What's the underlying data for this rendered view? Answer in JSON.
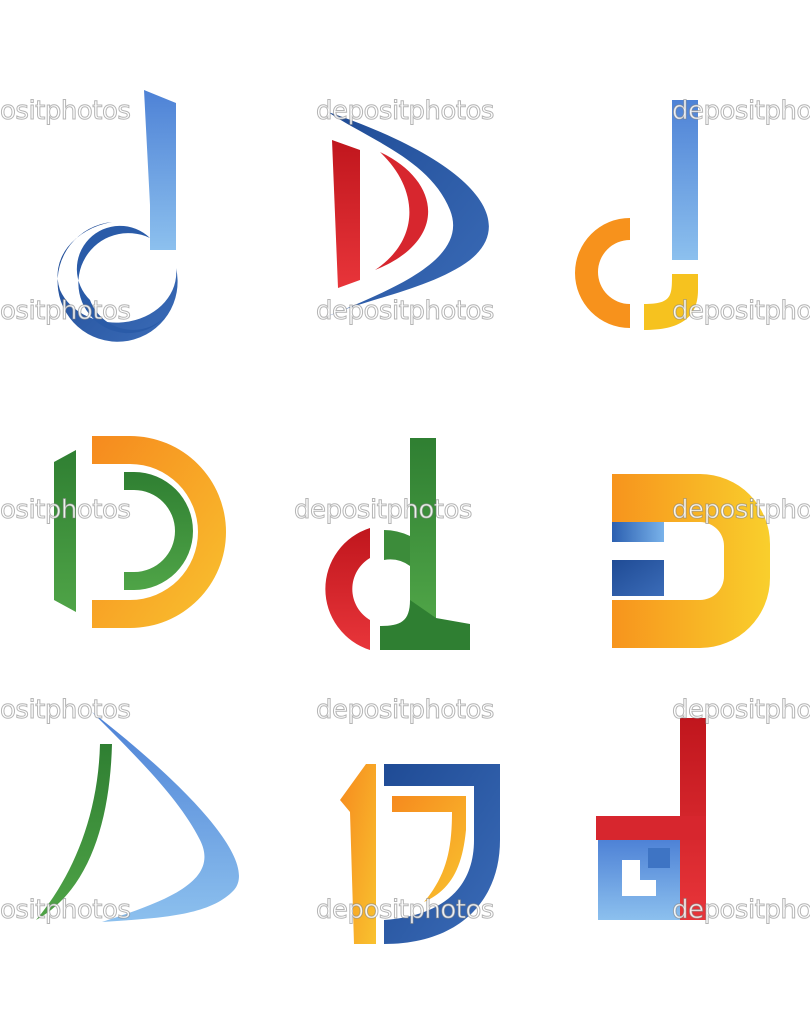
{
  "watermark": {
    "text": "depositphotos",
    "partial_text": "ositphotos"
  },
  "logos": [
    {
      "name": "letter-d-blue-swirl"
    },
    {
      "name": "letter-d-red-blue-sail"
    },
    {
      "name": "letter-d-orange-blue"
    },
    {
      "name": "letter-d-green-orange-rings"
    },
    {
      "name": "letter-d-red-green-lowercase"
    },
    {
      "name": "letter-d-orange-yellow-blocks"
    },
    {
      "name": "letter-d-green-blue-sail"
    },
    {
      "name": "letter-d-orange-blue-shield"
    },
    {
      "name": "letter-d-red-blue-squares"
    }
  ],
  "colors": {
    "blue_dark": "#2a4f9a",
    "blue_light": "#6fa6e3",
    "red": "#d7262e",
    "orange": "#f7951c",
    "yellow": "#f6c92c",
    "green": "#3c8c3a"
  }
}
